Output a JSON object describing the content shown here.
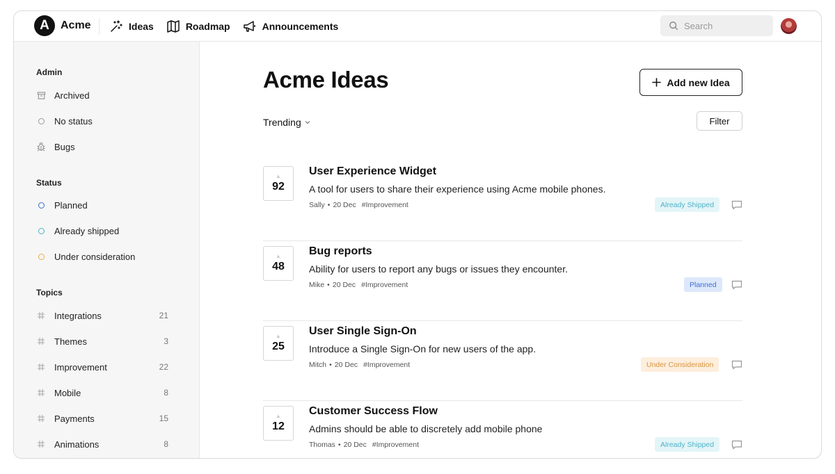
{
  "header": {
    "logo_letter": "A",
    "brand": "Acme",
    "nav": [
      {
        "label": "Ideas",
        "icon": "magic-wand-icon"
      },
      {
        "label": "Roadmap",
        "icon": "map-icon"
      },
      {
        "label": "Announcements",
        "icon": "megaphone-icon"
      }
    ],
    "search_placeholder": "Search"
  },
  "sidebar": {
    "admin_title": "Admin",
    "admin_items": [
      {
        "label": "Archived",
        "icon": "archive-icon"
      },
      {
        "label": "No status",
        "icon": "circle-icon"
      },
      {
        "label": "Bugs",
        "icon": "bug-icon"
      }
    ],
    "status_title": "Status",
    "status_items": [
      {
        "label": "Planned",
        "color": "#3d6fd1"
      },
      {
        "label": "Already shipped",
        "color": "#4cb3c8"
      },
      {
        "label": "Under consideration",
        "color": "#e8b04a"
      }
    ],
    "topics_title": "Topics",
    "topics": [
      {
        "label": "Integrations",
        "count": "21"
      },
      {
        "label": "Themes",
        "count": "3"
      },
      {
        "label": "Improvement",
        "count": "22"
      },
      {
        "label": "Mobile",
        "count": "8"
      },
      {
        "label": "Payments",
        "count": "15"
      },
      {
        "label": "Animations",
        "count": "8"
      }
    ]
  },
  "main": {
    "title": "Acme Ideas",
    "add_button": "Add new Idea",
    "sort_label": "Trending",
    "filter_label": "Filter",
    "ideas": [
      {
        "votes": "92",
        "title": "User Experience Widget",
        "desc": "A tool for users to share their experience using Acme mobile phones.",
        "author": "Sally",
        "date": "20 Dec",
        "tag": "#Improvement",
        "status": "Already Shipped"
      },
      {
        "votes": "48",
        "title": "Bug reports",
        "desc": "Ability for users to report any bugs or issues they encounter.",
        "author": "Mike",
        "date": "20 Dec",
        "tag": "#Improvement",
        "status": "Planned"
      },
      {
        "votes": "25",
        "title": "User Single Sign-On",
        "desc": "Introduce a Single Sign-On for new users of the app.",
        "author": "Mitch",
        "date": "20 Dec",
        "tag": "#Improvement",
        "status": "Under Consideration"
      },
      {
        "votes": "12",
        "title": "Customer Success Flow",
        "desc": "Admins should be able to discretely add mobile phone",
        "author": "Thomas",
        "date": "20 Dec",
        "tag": "#Improvement",
        "status": "Already Shipped"
      }
    ]
  }
}
